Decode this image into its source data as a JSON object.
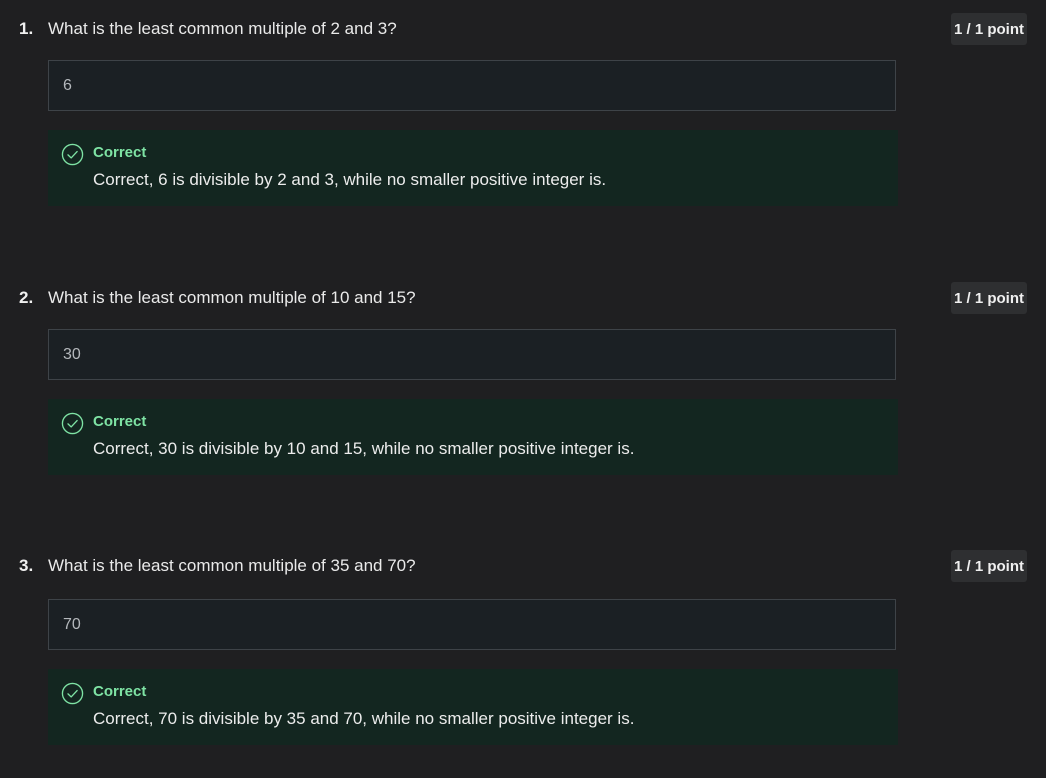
{
  "questions": [
    {
      "number": "1.",
      "text": "What is the least common multiple of 2 and 3?",
      "points": "1 / 1 point",
      "answer": "6",
      "feedback_title": "Correct",
      "feedback_text": "Correct, 6 is divisible by 2 and 3, while no smaller positive integer is."
    },
    {
      "number": "2.",
      "text": "What is the least common multiple of 10 and 15?",
      "points": "1 / 1 point",
      "answer": "30",
      "feedback_title": "Correct",
      "feedback_text": "Correct, 30 is divisible by 10 and 15, while no smaller positive integer is."
    },
    {
      "number": "3.",
      "text": "What is the least common multiple of 35 and 70?",
      "points": "1 / 1 point",
      "answer": "70",
      "feedback_title": "Correct",
      "feedback_text": "Correct, 70 is divisible by 35 and 70, while no smaller positive integer is."
    }
  ],
  "colors": {
    "background": "#1f1f21",
    "answer_box": "#1b2024",
    "feedback_bg": "#132620",
    "correct_green": "#7ee3a4",
    "badge_bg": "#2e2f31"
  },
  "icons": {
    "feedback": "check-circle-icon"
  }
}
